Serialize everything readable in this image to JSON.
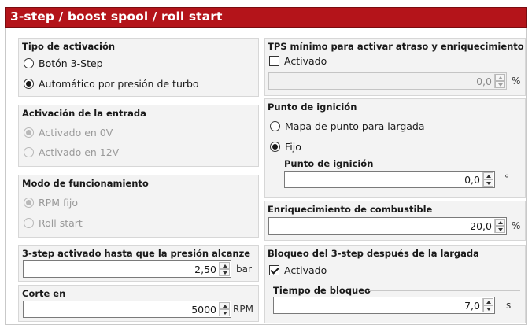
{
  "window": {
    "title": "3-step / boost spool / roll start"
  },
  "activation_type": {
    "title": "Tipo de activación",
    "options": [
      {
        "label": "Botón 3-Step",
        "selected": false
      },
      {
        "label": "Automático por presión de turbo",
        "selected": true
      }
    ]
  },
  "input_activation": {
    "title": "Activación de la entrada",
    "options": [
      {
        "label": "Activado en 0V",
        "selected": true,
        "enabled": false
      },
      {
        "label": "Activado en 12V",
        "selected": false,
        "enabled": false
      }
    ]
  },
  "operating_mode": {
    "title": "Modo de funcionamiento",
    "options": [
      {
        "label": "RPM fijo",
        "selected": true,
        "enabled": false
      },
      {
        "label": "Roll start",
        "selected": false,
        "enabled": false
      }
    ]
  },
  "pressure_limit": {
    "title": "3-step activado hasta que la presión alcanze",
    "value": "2,50",
    "unit": "bar"
  },
  "cut": {
    "title": "Corte en",
    "value": "5000",
    "unit": "RPM"
  },
  "min_tps": {
    "title": "TPS mínimo para activar atraso y enriquecimiento",
    "checkbox_label": "Activado",
    "checked": false,
    "value": "0,0",
    "unit": "%"
  },
  "ignition_point": {
    "title": "Punto de ignición",
    "options": [
      {
        "label": "Mapa de punto para largada",
        "selected": false
      },
      {
        "label": "Fijo",
        "selected": true
      }
    ],
    "sub_label": "Punto de ignición",
    "value": "0,0",
    "unit": "°"
  },
  "fuel_enrichment": {
    "title": "Enriquecimiento de combustible",
    "value": "20,0",
    "unit": "%"
  },
  "lockout": {
    "title": "Bloqueo del 3-step después de la largada",
    "checkbox_label": "Activado",
    "checked": true,
    "sub_label": "Tiempo de bloqueo",
    "value": "7,0",
    "unit": "s"
  },
  "colors": {
    "title_bar": "#b4141a",
    "group_bg": "#f3f3f3"
  }
}
